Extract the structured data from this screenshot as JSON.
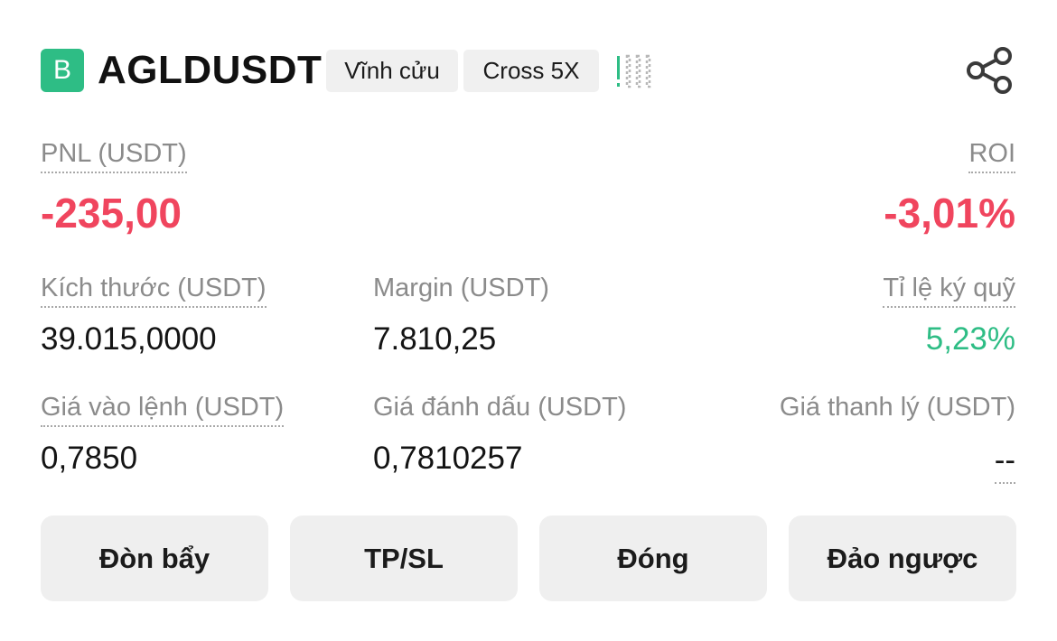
{
  "header": {
    "side_badge": "B",
    "symbol": "AGLDUSDT",
    "tags": [
      "Vĩnh cửu",
      "Cross 5X"
    ],
    "signal_icon": "signal-bars-icon",
    "share_icon": "share-icon"
  },
  "pnl": {
    "label": "PNL (USDT)",
    "value": "-235,00"
  },
  "roi": {
    "label": "ROI",
    "value": "-3,01%"
  },
  "stats": {
    "size": {
      "label": "Kích thước (USDT)",
      "value": "39.015,0000"
    },
    "margin": {
      "label": "Margin (USDT)",
      "value": "7.810,25"
    },
    "margin_ratio": {
      "label": "Tỉ lệ ký quỹ",
      "value": "5,23%"
    },
    "entry_price": {
      "label": "Giá vào lệnh (USDT)",
      "value": "0,7850"
    },
    "mark_price": {
      "label": "Giá đánh dấu (USDT)",
      "value": "0,7810257"
    },
    "liq_price": {
      "label": "Giá thanh lý (USDT)",
      "value": "--"
    }
  },
  "buttons": {
    "leverage": "Đòn bẩy",
    "tpsl": "TP/SL",
    "close": "Đóng",
    "reverse": "Đảo ngược"
  },
  "colors": {
    "buy": "#2ebd85",
    "loss": "#f0455e",
    "button_bg": "#efefef"
  }
}
